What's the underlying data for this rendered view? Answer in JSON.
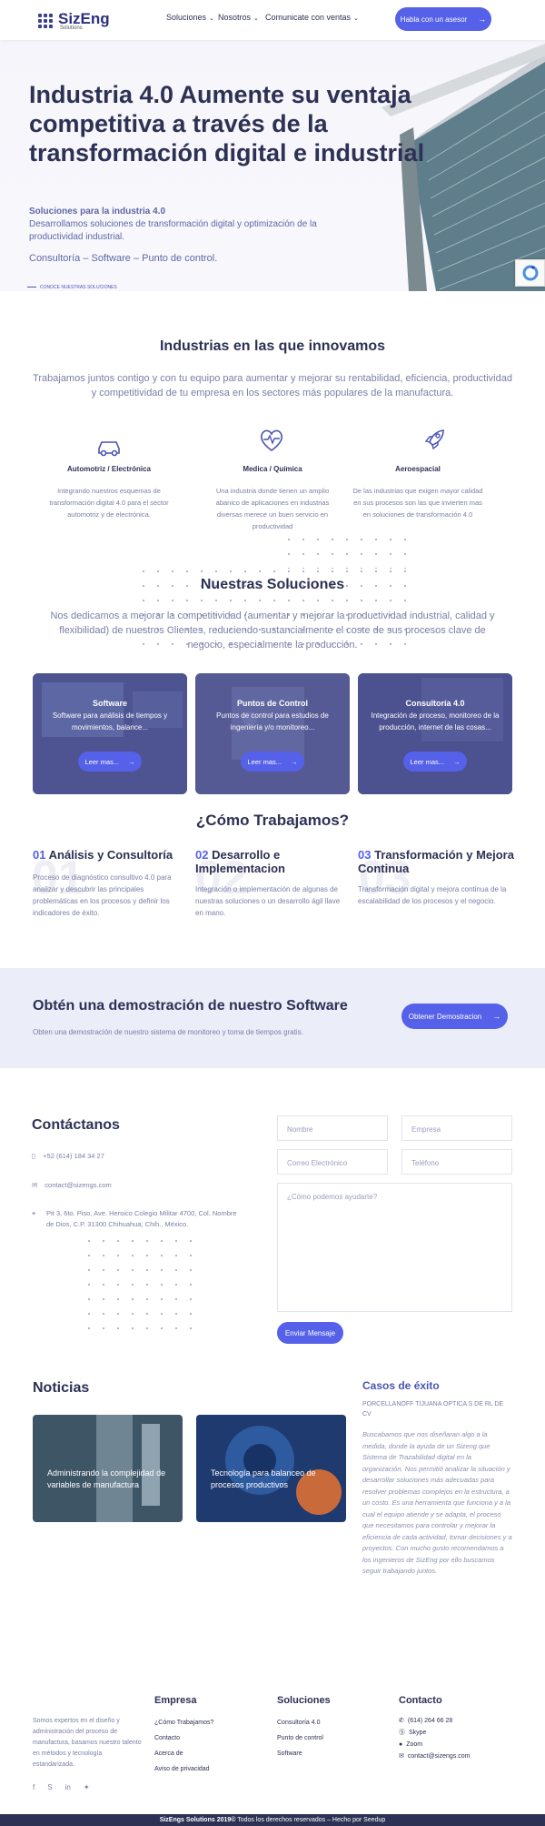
{
  "header": {
    "logo_name": "SizEng",
    "logo_sub": "Solutions",
    "nav": [
      "Soluciones",
      "Nosotros",
      "Comunicate con ventas"
    ],
    "cta": "Habla con un asesor"
  },
  "hero": {
    "title": "Industria 4.0 Aumente su ventaja competitiva a través de la transformación digital e industrial",
    "subtitle": "Soluciones para la industria 4.0",
    "description": "Desarrollamos soluciones de transformación digital y optimización de la productividad industrial.",
    "tagline": "Consultoría – Software – Punto de control.",
    "link": "CONOCE NUESTRAS SOLUCIONES"
  },
  "industries": {
    "title": "Industrias en las que innovamos",
    "text": "Trabajamos juntos contigo y con tu equipo para aumentar y mejorar su rentabilidad, eficiencia, productividad y competitividad de tu empresa  en los sectores más populares de la manufactura.",
    "items": [
      {
        "icon": "car-icon",
        "name": "Automotriz / Electrónica",
        "text": "Integrando nuestros esquemas de transformación digital 4.0 para el sector automotriz y de electrónica."
      },
      {
        "icon": "heart-pulse-icon",
        "name": "Medica / Química",
        "text": "Una industria donde tienen un amplio abanico de aplicaciones en industrias diversas merece un buen servicio en productividad"
      },
      {
        "icon": "rocket-icon",
        "name": "Aeroespacial",
        "text": "De las industrias que exigen mayor calidad en sus procesos son las que invierten mas en soluciones de transformación 4.0"
      }
    ]
  },
  "solutions": {
    "title": "Nuestras Soluciones",
    "text": "Nos dedicamos a mejorar la competitividad (aumentar y mejorar la productividad industrial, calidad y flexibilidad) de nuestros Clientes, reduciendo sustancialmente el coste de sus procesos clave de negocio, especialmente la producción.",
    "cards": [
      {
        "title": "Software",
        "text": "Software para análisis de tiempos y movimientos, balance...",
        "button": "Leer mas..."
      },
      {
        "title": "Puntos de Control",
        "text": "Puntos de control para estudios de ingeniería y/o monitoreo...",
        "button": "Leer mas..."
      },
      {
        "title": "Consultoría 4.0",
        "text": "Integración de proceso, monitoreo de la producción, internet de las cosas...",
        "button": "Leer mas..."
      }
    ]
  },
  "how": {
    "title": "¿Cómo Trabajamos?",
    "steps": [
      {
        "num": "01",
        "title": "Análisis y Consultoría",
        "text": "Proceso de diagnóstico consultivo 4.0 para analizar y descubrir las principales problemáticas en los procesos y definir los indicadores de éxito."
      },
      {
        "num": "02",
        "title": "Desarrollo e Implementacion",
        "text": "Integración o implementación de algunas de nuestras soluciones o un desarrollo ágil llave en mano."
      },
      {
        "num": "03",
        "title": "Transformación y Mejora Continua",
        "text": "Transformación digital y mejora continua de la escalabilidad de los procesos y el negocio."
      }
    ]
  },
  "demo": {
    "title": "Obtén una demostración de nuestro Software",
    "text": "Obten una demostración de nuestro sistema de monitoreo y toma de tiempos gratis.",
    "button": "Obtener Demostracion"
  },
  "contact": {
    "title": "Contáctanos",
    "phone": "+52 (614) 184 34 27",
    "email": "contact@sizengs.com",
    "address": "Pit 3, 6to. Piso, Ave. Heroico Colegio Militar 4700, Col. Nombre de Dios, C.P. 31300 Chihuahua, Chih., México.",
    "form": {
      "name": "Nombre",
      "company": "Empresa",
      "email": "Correo Electrónico",
      "phone": "Teléfono",
      "message": "¿Cómo podemos ayudarte?",
      "submit": "Enviar Mensaje"
    }
  },
  "news": {
    "title": "Noticias",
    "items": [
      "Administrando la complejidad de variables de manufactura",
      "Tecnología para balanceo de procesos productivos"
    ]
  },
  "cases": {
    "title": "Casos de éxito",
    "company": "PORCELLANOFF TIJUANA OPTICA S DE RL DE CV",
    "text": "Buscabamos que nos diseñaran algo a la medida, donde la ayuda de un Sizeng que Sistema de Trazabilidad digital en la organización. Nos permitió analizar la situación y desarrollar soluciones más adecuadas para resolver problemas complejos en la estructura, a un costo. Es una herramienta que funciona y a la cual el equipo atiende y se adapta, el proceso que necesitamos para controlar y mejorar la eficiencia de cada actividad, tomar decisiones y a proyectos. Con mucho gusto recomendamos a los ingenieros de SizEng por ello buscamos seguir trabajando juntos."
  },
  "footer": {
    "about": "Somos expertos en el diseño y administración del proceso de manufactura, basamos nuestro talento en métodos y tecnología estandarizada.",
    "empresa_title": "Empresa",
    "empresa": [
      "¿Cómo Trabajamos?",
      "Contacto",
      "Acerca de",
      "Aviso de privacidad"
    ],
    "soluciones_title": "Soluciones",
    "soluciones": [
      "Consultoría 4.0",
      "Punto de control",
      "Software"
    ],
    "contacto_title": "Contacto",
    "contacto": [
      "(614) 264 66 28",
      "Skype",
      "Zoom",
      "contact@sizengs.com"
    ],
    "copyright_brand": "SizEngs Solutions 2019©",
    "copyright": "Todos los derechos reservados – Hecho por Seedup"
  }
}
